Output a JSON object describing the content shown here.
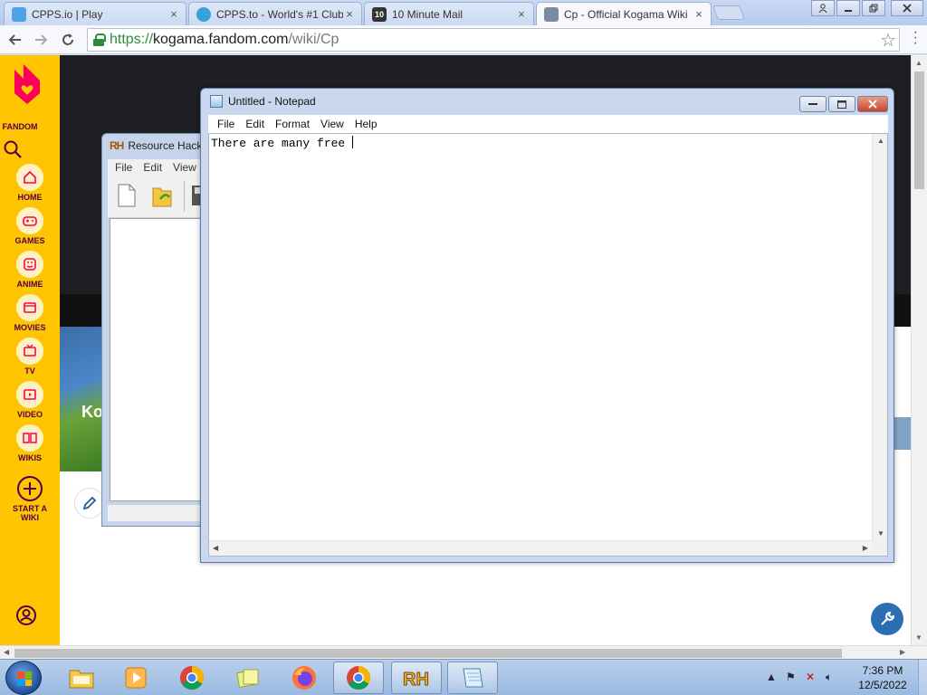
{
  "browser": {
    "tabs": [
      {
        "title": "CPPS.io | Play",
        "icon_color": "#4da3e8",
        "icon_label": ""
      },
      {
        "title": "CPPS.to - World's #1 Club",
        "icon_color": "#39a0d8",
        "icon_label": ""
      },
      {
        "title": "10 Minute Mail",
        "icon_color": "#333333",
        "icon_label": "10"
      },
      {
        "title": "Cp - Official Kogama Wiki",
        "icon_color": "#7a8aa0",
        "icon_label": ""
      }
    ],
    "close_glyph": "×",
    "window_controls": [
      "person-icon",
      "minimize-icon",
      "maximize-icon",
      "close-icon"
    ],
    "url": {
      "scheme": "https://",
      "host": "kogama.fandom.com",
      "path": "/wiki/Cp"
    }
  },
  "fandom": {
    "brand": "FANDOM",
    "nav": [
      {
        "label": "HOME",
        "icon": "home-icon"
      },
      {
        "label": "GAMES",
        "icon": "gamepad-icon"
      },
      {
        "label": "ANIME",
        "icon": "anime-icon"
      },
      {
        "label": "MOVIES",
        "icon": "movie-icon"
      },
      {
        "label": "TV",
        "icon": "tv-icon"
      },
      {
        "label": "VIDEO",
        "icon": "video-icon"
      },
      {
        "label": "WIKIS",
        "icon": "book-icon"
      },
      {
        "label": "START A WIKI",
        "icon": "plus-circle-icon"
      }
    ],
    "wiki_title_partial": "Ko",
    "accent": "#ffc500",
    "ink": "#520044"
  },
  "resource_hacker": {
    "title": "Resource Hack",
    "logo": "RH",
    "menu": [
      "File",
      "Edit",
      "View"
    ]
  },
  "notepad": {
    "title": "Untitled - Notepad",
    "menu": [
      "File",
      "Edit",
      "Format",
      "View",
      "Help"
    ],
    "text": "There are many free "
  },
  "taskbar": {
    "items": [
      {
        "name": "explorer",
        "icon": "folder-icon",
        "open": false
      },
      {
        "name": "media-player",
        "icon": "media-player-icon",
        "open": false
      },
      {
        "name": "chrome-pinned",
        "icon": "chrome-icon",
        "open": false
      },
      {
        "name": "sticky-notes",
        "icon": "sticky-notes-icon",
        "open": false
      },
      {
        "name": "firefox",
        "icon": "firefox-icon",
        "open": false
      },
      {
        "name": "chrome",
        "icon": "chrome-icon",
        "open": true
      },
      {
        "name": "resource-hacker",
        "icon": "rh-icon",
        "open": true
      },
      {
        "name": "notepad",
        "icon": "notepad-icon",
        "open": true
      }
    ],
    "time": "7:36 PM",
    "date": "12/5/2022"
  }
}
